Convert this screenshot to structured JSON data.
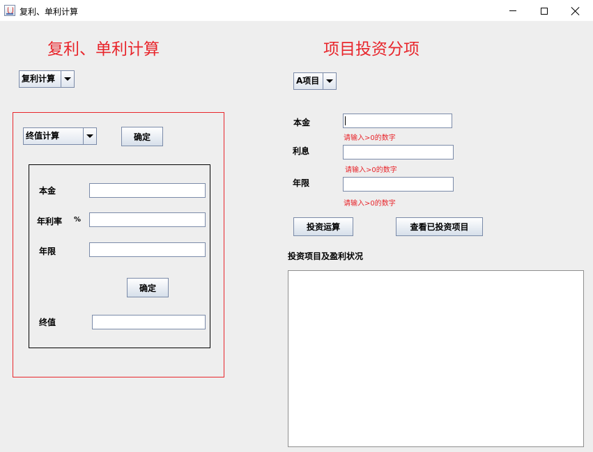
{
  "window": {
    "title": "复利、单利计算",
    "icon": "java-icon"
  },
  "left": {
    "heading": "复利、单利计算",
    "mode_select": {
      "value": "复利计算"
    },
    "calc_select": {
      "value": "终值计算"
    },
    "confirm_top_label": "确定",
    "principal_label": "本金",
    "rate_label": "年利率",
    "rate_unit": "%",
    "years_label": "年限",
    "confirm_label": "确定",
    "result_label": "终值",
    "principal_value": "",
    "rate_value": "",
    "years_value": "",
    "result_value": ""
  },
  "right": {
    "heading": "项目投资分项",
    "project_select": {
      "value": "A项目"
    },
    "principal_label": "本金",
    "interest_label": "利息",
    "years_label": "年限",
    "hint_principal": "请输入>0的数字",
    "hint_interest": "请输入>0的数字",
    "hint_years": "请输入>0的数字",
    "principal_value": "",
    "interest_value": "",
    "years_value": "",
    "invest_button": "投资运算",
    "view_button": "查看已投资项目",
    "status_label": "投资项目及盈利状况",
    "status_text": ""
  },
  "colors": {
    "accent_red": "#e8252b",
    "background": "#eeeeee"
  }
}
